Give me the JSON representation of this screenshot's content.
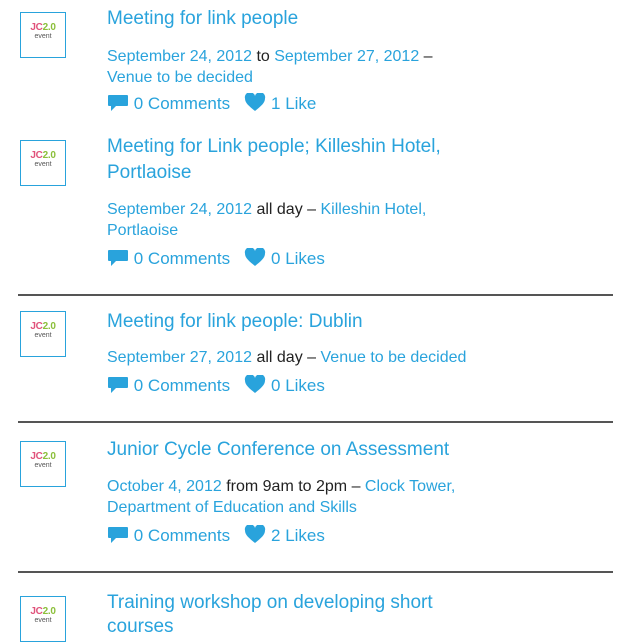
{
  "thumb": {
    "brand_jc": "JC",
    "brand_ver": "2.0",
    "kind": "event"
  },
  "events": [
    {
      "title": "Meeting for link people",
      "line1": {
        "start": "September 24, 2012",
        "mid": " to ",
        "end": "September 27, 2012",
        "dash": " –"
      },
      "line2": {
        "venue": "Venue to be decided"
      },
      "comments": "0 Comments",
      "likes": "1 Like"
    },
    {
      "title_line1": "Meeting for Link people; Killeshin Hotel,",
      "title_line2": "Portlaoise",
      "line1": {
        "start": "September 24, 2012",
        "mid": " all day",
        "dash": " – ",
        "venue": "Killeshin Hotel,"
      },
      "line2": {
        "venue": "Portlaoise"
      },
      "comments": "0 Comments",
      "likes": "0 Likes"
    },
    {
      "title": "Meeting for link people: Dublin",
      "line1": {
        "start": "September 27, 2012",
        "mid": " all day",
        "dash": " – ",
        "venue": "Venue to be decided"
      },
      "comments": "0 Comments",
      "likes": "0 Likes"
    },
    {
      "title": "Junior Cycle Conference on Assessment",
      "line1": {
        "start": "October 4, 2012",
        "mid": " from 9am to 2pm",
        "dash": " – ",
        "venue": "Clock Tower,"
      },
      "line2": {
        "venue": "Department of Education and Skills"
      },
      "comments": "0 Comments",
      "likes": "2 Likes"
    },
    {
      "title_line1": "Training workshop on developing short",
      "title_line2": "courses"
    }
  ],
  "icons": {
    "comment": "comment-bubble-icon",
    "like": "heart-icon",
    "accent": "#29a3dc"
  }
}
